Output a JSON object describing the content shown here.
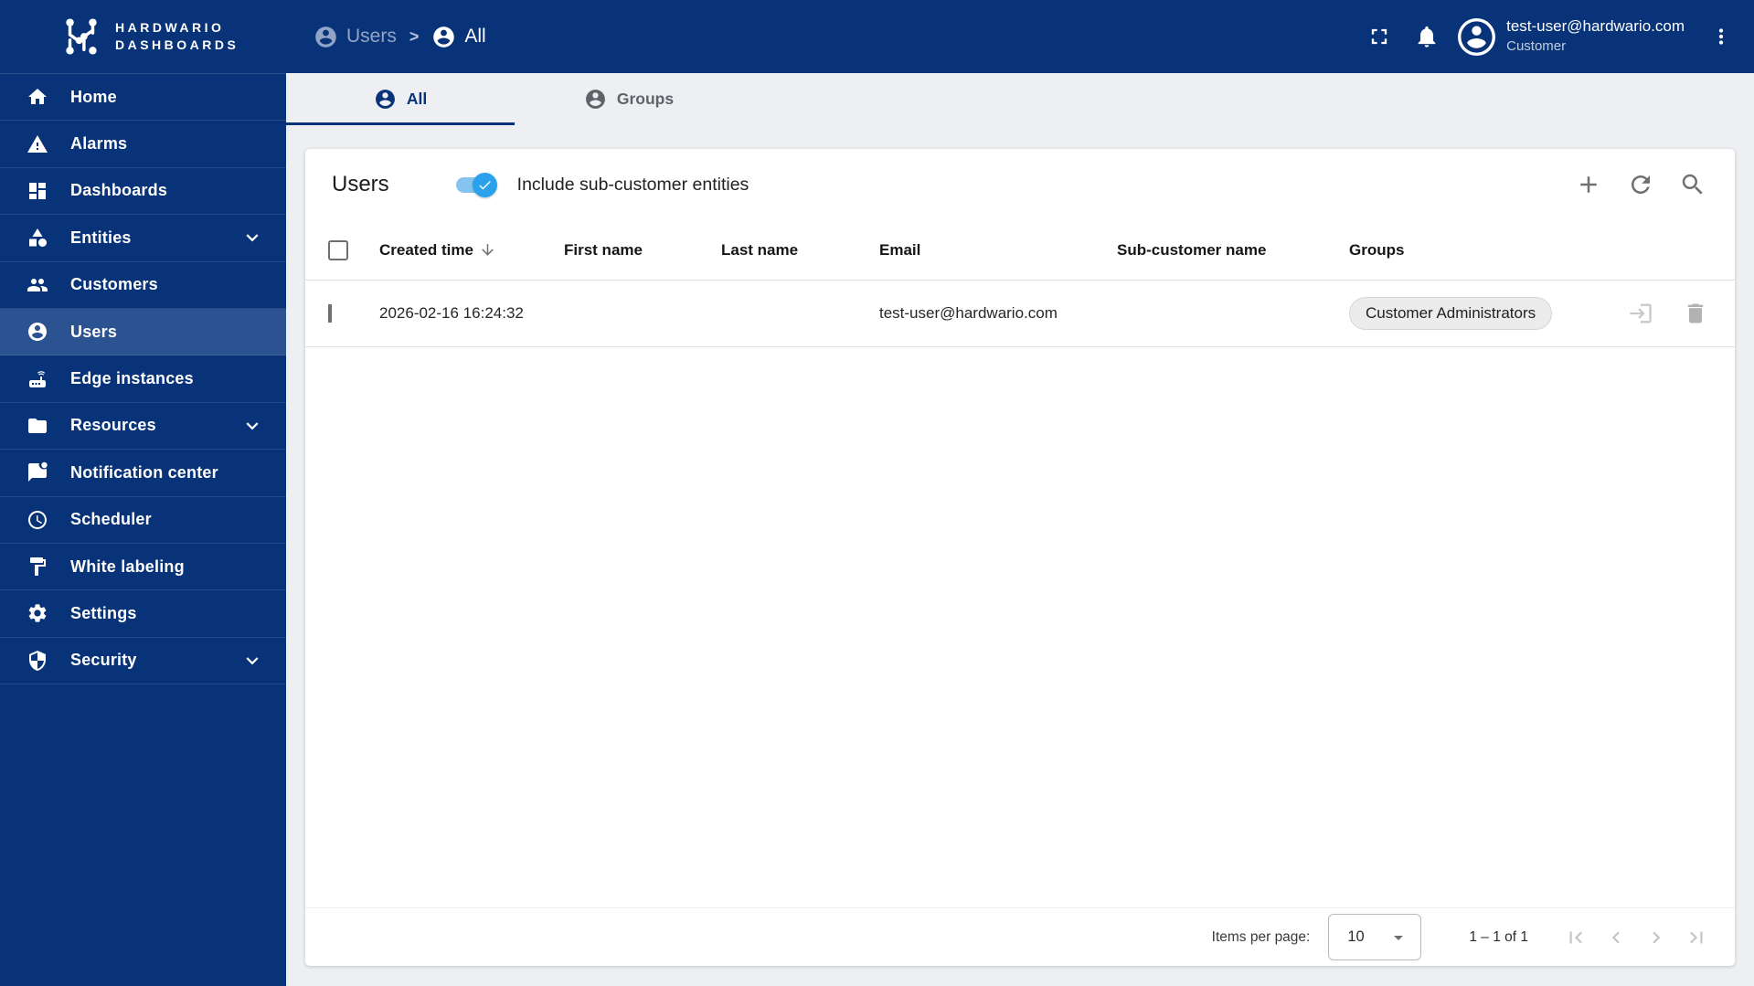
{
  "colors": {
    "primary": "#083378",
    "sidebar_selected": "#2b5291",
    "toggle_accent": "#2aa1ec",
    "content_background": "#edeff3"
  },
  "brand": {
    "line1": "HARDWARIO",
    "line2": "DASHBOARDS"
  },
  "header": {
    "breadcrumb": {
      "separator": ">",
      "items": [
        {
          "label": "Users",
          "icon": "account"
        },
        {
          "label": "All",
          "icon": "account"
        }
      ]
    },
    "actions": [
      {
        "name": "fullscreen"
      },
      {
        "name": "notifications"
      }
    ],
    "account": {
      "email": "test-user@hardwario.com",
      "role": "Customer",
      "icon": "person"
    }
  },
  "sidebar": {
    "items": [
      {
        "label": "Home",
        "icon": "home",
        "active": false,
        "expandable": false
      },
      {
        "label": "Alarms",
        "icon": "warning",
        "active": false,
        "expandable": false
      },
      {
        "label": "Dashboards",
        "icon": "dashboards",
        "active": false,
        "expandable": false
      },
      {
        "label": "Entities",
        "icon": "shapes",
        "active": false,
        "expandable": true
      },
      {
        "label": "Customers",
        "icon": "people",
        "active": false,
        "expandable": false
      },
      {
        "label": "Users",
        "icon": "account",
        "active": true,
        "expandable": false
      },
      {
        "label": "Edge instances",
        "icon": "router",
        "active": false,
        "expandable": false
      },
      {
        "label": "Resources",
        "icon": "folder",
        "active": false,
        "expandable": true
      },
      {
        "label": "Notification center",
        "icon": "chat-dot",
        "active": false,
        "expandable": false
      },
      {
        "label": "Scheduler",
        "icon": "clock",
        "active": false,
        "expandable": false
      },
      {
        "label": "White labeling",
        "icon": "paint",
        "active": false,
        "expandable": false
      },
      {
        "label": "Settings",
        "icon": "gear",
        "active": false,
        "expandable": false
      },
      {
        "label": "Security",
        "icon": "shield",
        "active": false,
        "expandable": true
      }
    ]
  },
  "tabs": [
    {
      "label": "All",
      "icon": "account",
      "active": true
    },
    {
      "label": "Groups",
      "icon": "account",
      "active": false
    }
  ],
  "content": {
    "title": "Users",
    "toggle": {
      "label": "Include sub-customer entities",
      "on": true
    },
    "toolbar": [
      {
        "name": "add"
      },
      {
        "name": "refresh"
      },
      {
        "name": "search"
      }
    ]
  },
  "table": {
    "columns": [
      "Created time",
      "First name",
      "Last name",
      "Email",
      "Sub-customer name",
      "Groups"
    ],
    "sort": {
      "column": "Created time",
      "direction": "desc"
    },
    "rows": [
      {
        "selected": false,
        "created_time": "2026-02-16 16:24:32",
        "first_name": "",
        "last_name": "",
        "email": "test-user@hardwario.com",
        "sub_customer_name": "",
        "groups": [
          "Customer Administrators"
        ],
        "actions": [
          {
            "name": "login-as-user"
          },
          {
            "name": "delete"
          }
        ]
      }
    ]
  },
  "paginator": {
    "items_per_page_label": "Items per page:",
    "page_size": "10",
    "range_label": "1 – 1 of 1"
  }
}
